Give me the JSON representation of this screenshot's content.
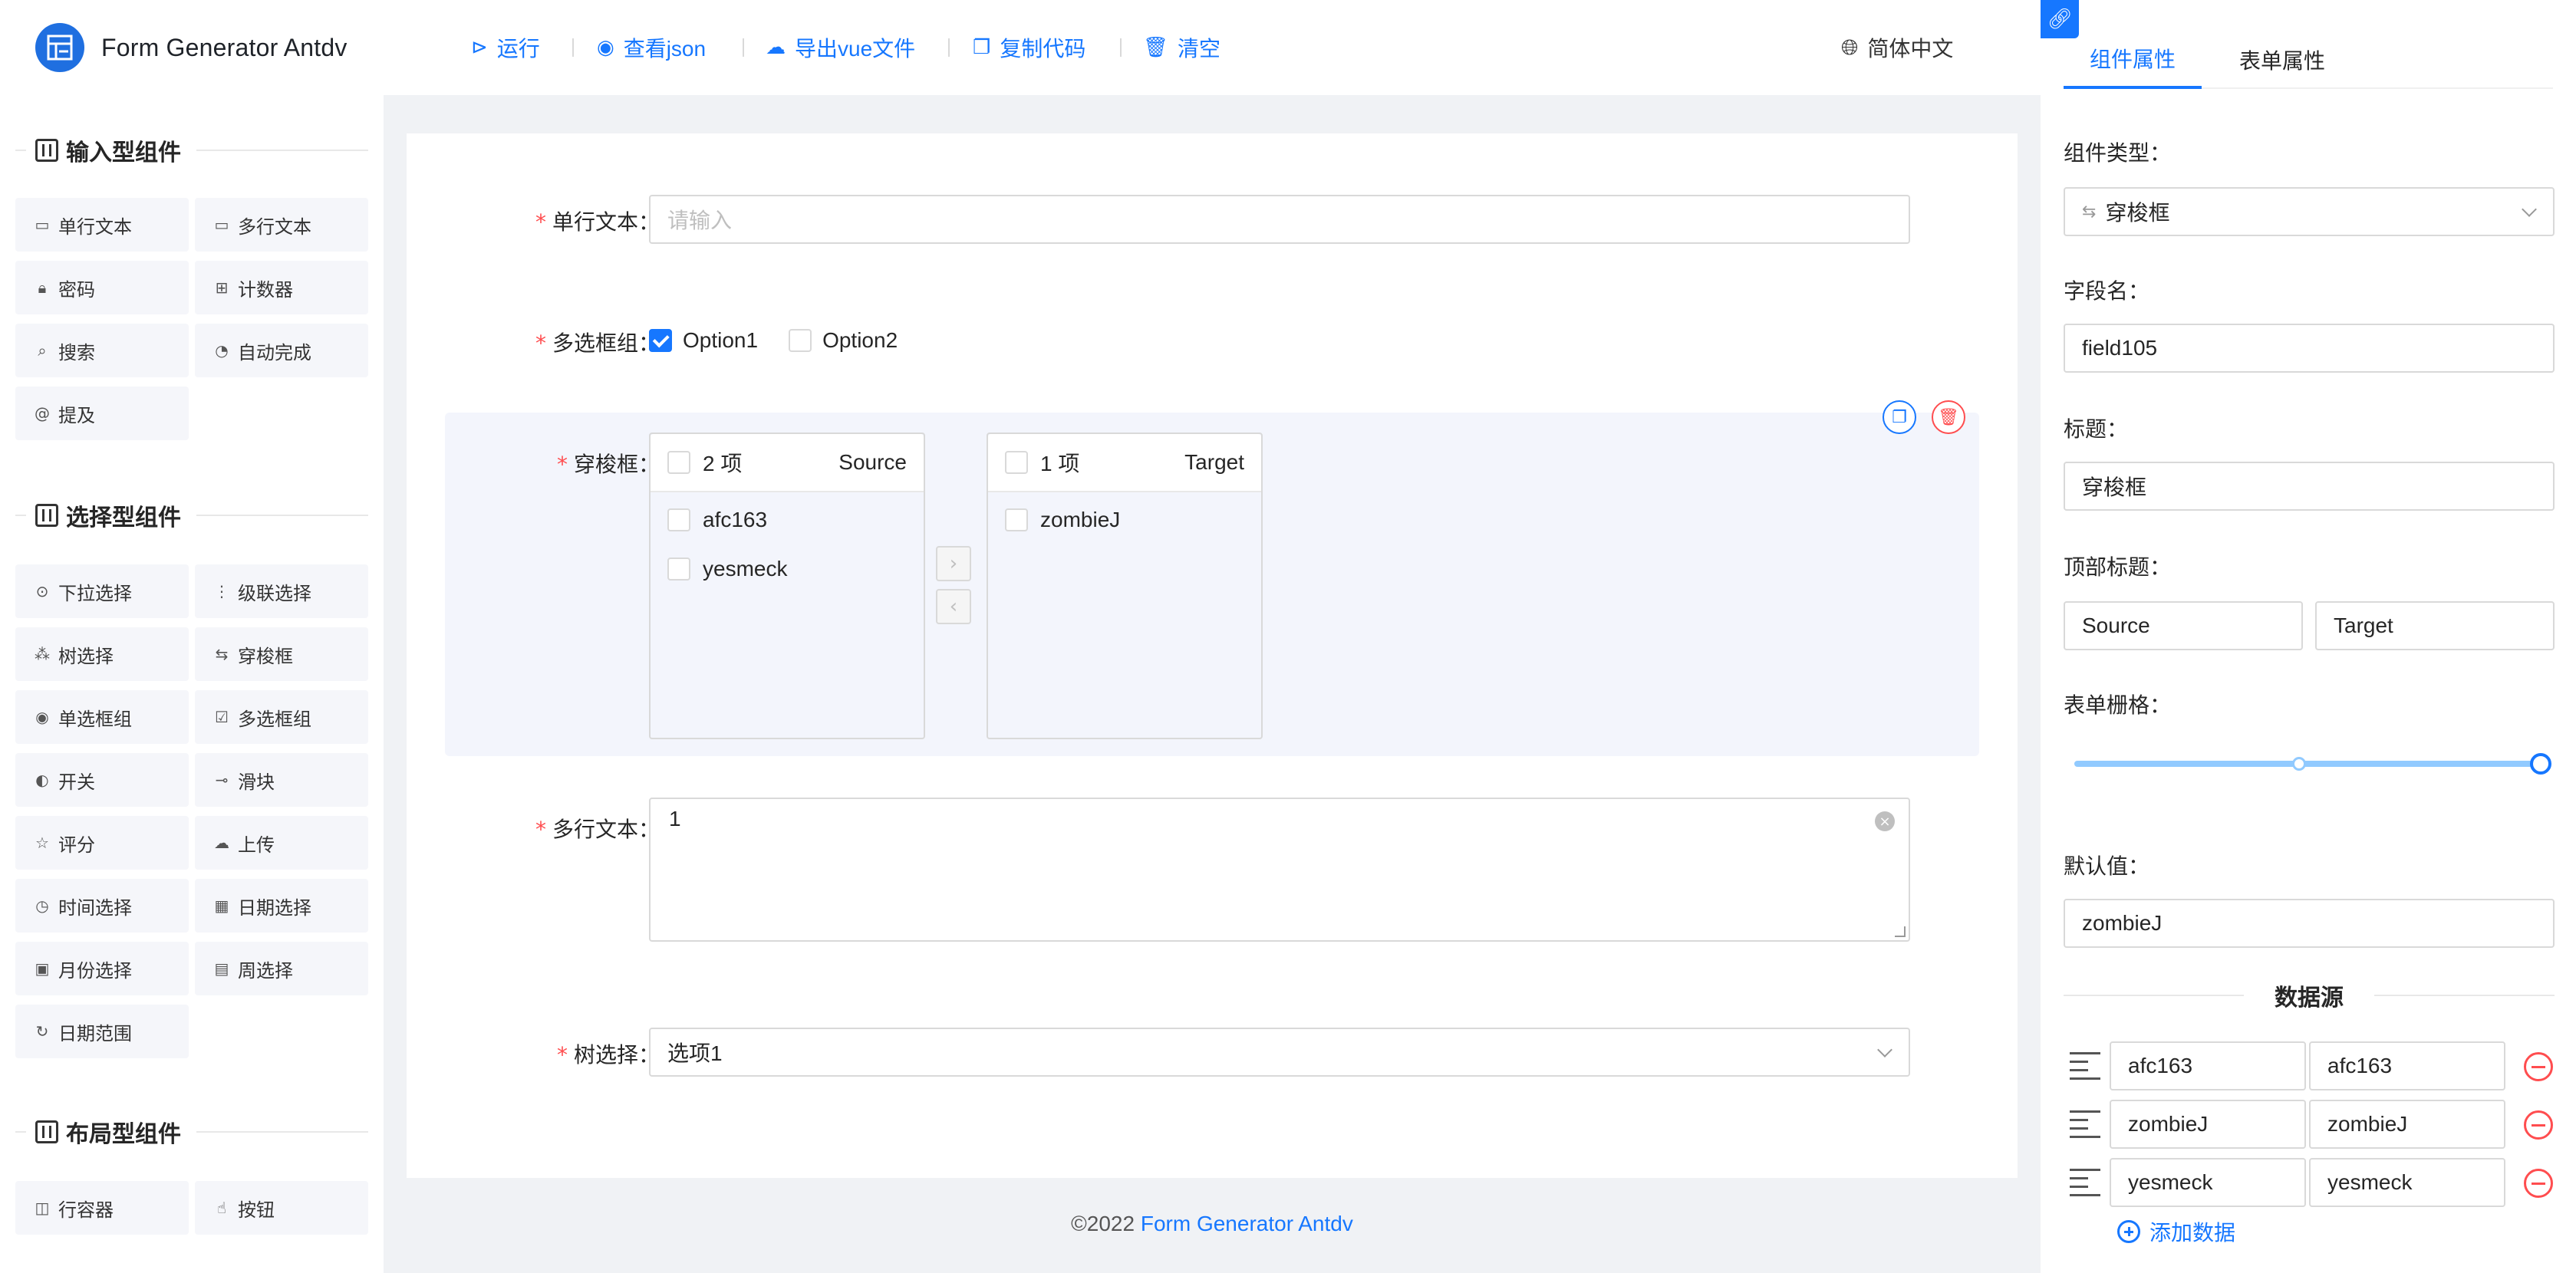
{
  "app": {
    "title": "Form Generator Antdv"
  },
  "toolbar": {
    "run": "运行",
    "view_json": "查看json",
    "export_vue": "导出vue文件",
    "copy_code": "复制代码",
    "clear": "清空",
    "language": "简体中文"
  },
  "palette": {
    "input_group": {
      "title": "输入型组件",
      "items": [
        {
          "label": "单行文本",
          "icon": "input-icon"
        },
        {
          "label": "多行文本",
          "icon": "textarea-icon"
        },
        {
          "label": "密码",
          "icon": "lock-icon"
        },
        {
          "label": "计数器",
          "icon": "counter-icon"
        },
        {
          "label": "搜索",
          "icon": "search-icon"
        },
        {
          "label": "自动完成",
          "icon": "autocomplete-icon"
        },
        {
          "label": "提及",
          "icon": "at-icon"
        }
      ]
    },
    "select_group": {
      "title": "选择型组件",
      "items": [
        {
          "label": "下拉选择",
          "icon": "select-icon"
        },
        {
          "label": "级联选择",
          "icon": "cascader-icon"
        },
        {
          "label": "树选择",
          "icon": "tree-icon"
        },
        {
          "label": "穿梭框",
          "icon": "transfer-icon"
        },
        {
          "label": "单选框组",
          "icon": "radio-icon"
        },
        {
          "label": "多选框组",
          "icon": "checkbox-icon"
        },
        {
          "label": "开关",
          "icon": "switch-icon"
        },
        {
          "label": "滑块",
          "icon": "slider-icon"
        },
        {
          "label": "评分",
          "icon": "star-icon"
        },
        {
          "label": "上传",
          "icon": "upload-icon"
        },
        {
          "label": "时间选择",
          "icon": "clock-icon"
        },
        {
          "label": "日期选择",
          "icon": "calendar-icon"
        },
        {
          "label": "月份选择",
          "icon": "month-icon"
        },
        {
          "label": "周选择",
          "icon": "week-icon"
        },
        {
          "label": "日期范围",
          "icon": "date-range-icon"
        }
      ]
    },
    "layout_group": {
      "title": "布局型组件",
      "items": [
        {
          "label": "行容器",
          "icon": "row-icon"
        },
        {
          "label": "按钮",
          "icon": "pointer-icon"
        }
      ]
    }
  },
  "canvas": {
    "fields": {
      "single_text": {
        "label": "单行文本",
        "placeholder": "请输入"
      },
      "checkbox_group": {
        "label": "多选框组",
        "options": [
          "Option1",
          "Option2"
        ],
        "checked": [
          "Option1"
        ]
      },
      "transfer": {
        "label": "穿梭框",
        "source": {
          "count": "2 项",
          "title": "Source",
          "items": [
            "afc163",
            "yesmeck"
          ]
        },
        "target": {
          "count": "1 项",
          "title": "Target",
          "items": [
            "zombieJ"
          ]
        }
      },
      "multi_text": {
        "label": "多行文本",
        "value": "1"
      },
      "tree_select": {
        "label": "树选择",
        "value": "选项1"
      }
    }
  },
  "footer": {
    "copyright": "©2022",
    "link_text": "Form Generator Antdv"
  },
  "props_panel": {
    "tabs": [
      "组件属性",
      "表单属性"
    ],
    "active_tab": "组件属性",
    "component_type": {
      "label": "组件类型",
      "value": "穿梭框"
    },
    "field_name": {
      "label": "字段名",
      "value": "field105"
    },
    "title": {
      "label": "标题",
      "value": "穿梭框"
    },
    "top_titles": {
      "label": "顶部标题",
      "source": "Source",
      "target": "Target"
    },
    "grid": {
      "label": "表单栅格",
      "value_fraction": 1.0
    },
    "default_value": {
      "label": "默认值",
      "value": "zombieJ"
    },
    "data_source": {
      "title": "数据源",
      "rows": [
        {
          "label": "afc163",
          "value": "afc163"
        },
        {
          "label": "zombieJ",
          "value": "zombieJ"
        },
        {
          "label": "yesmeck",
          "value": "yesmeck"
        }
      ],
      "add_label": "添加数据"
    }
  },
  "colors": {
    "primary": "#1677ff",
    "danger": "#ff4d4f",
    "canvas_bg": "#f0f2f5",
    "item_bg": "#f5f6fa"
  }
}
